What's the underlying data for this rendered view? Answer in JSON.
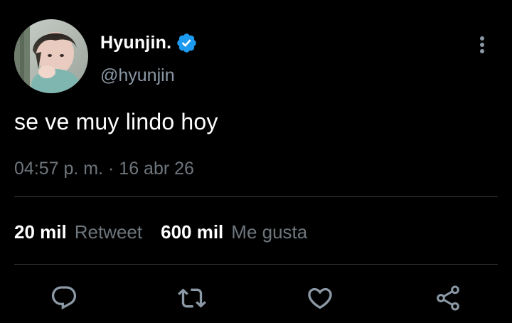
{
  "tweet": {
    "author": {
      "display_name": "Hyunjin.",
      "handle": "@hyunjin",
      "verified": true,
      "avatar": "avatar-photo"
    },
    "text": "se ve muy lindo hoy",
    "timestamp": "04:57 p. m. · 16 abr 26",
    "stats": {
      "retweets_count": "20 mil",
      "retweets_label": "Retweet",
      "likes_count": "600 mil",
      "likes_label": "Me gusta"
    },
    "actions": [
      {
        "icon": "reply-icon"
      },
      {
        "icon": "retweet-icon"
      },
      {
        "icon": "like-icon"
      },
      {
        "icon": "share-icon"
      }
    ]
  },
  "colors": {
    "background": "#000000",
    "primary_text": "#ffffff",
    "secondary_text": "#6e767d",
    "handle_text": "#8b98a5",
    "verified_blue": "#1d9bf0",
    "divider": "#2f3336",
    "icon_color": "#8b98a5"
  }
}
